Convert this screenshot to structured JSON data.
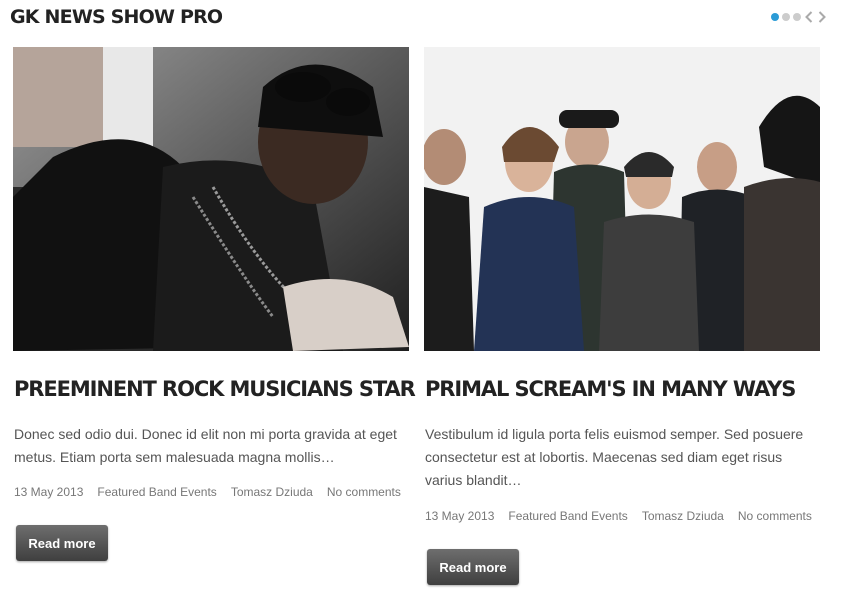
{
  "module": {
    "title": "GK NEWS SHOW PRO",
    "pager": {
      "page_count": 3,
      "active_page": 1,
      "prev_icon": "chevron-left-icon",
      "next_icon": "chevron-right-icon"
    }
  },
  "colors": {
    "accent": "#2b9bd6",
    "heading": "#222222",
    "text": "#555555",
    "meta": "#777777",
    "button_top": "#6e6e6e",
    "button_bottom": "#3f3f3f"
  },
  "articles": [
    {
      "title": "PREEMINENT ROCK MUSICIANS STAR",
      "excerpt": "Donec sed odio dui. Donec id elit non mi porta gravida at eget metus. Etiam porta sem malesuada magna mollis…",
      "date": "13 May 2013",
      "category": "Featured Band Events",
      "author": "Tomasz Dziuda",
      "comments": "No comments",
      "read_more": "Read more"
    },
    {
      "title": "PRIMAL SCREAM'S IN MANY WAYS",
      "excerpt": "Vestibulum id ligula porta felis euismod semper. Sed posuere consectetur est at lobortis. Maecenas sed diam eget risus varius blandit…",
      "date": "13 May 2013",
      "category": "Featured Band Events",
      "author": "Tomasz Dziuda",
      "comments": "No comments",
      "read_more": "Read more"
    }
  ]
}
